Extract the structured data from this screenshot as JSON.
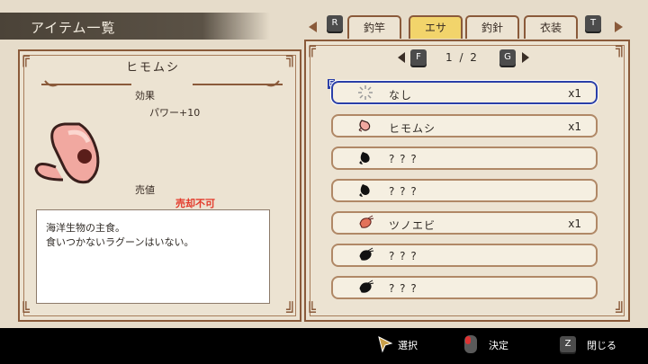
{
  "header": {
    "title": "アイテム一覧"
  },
  "tabs": {
    "left_key": "R",
    "right_key": "T",
    "items": [
      {
        "label": "釣竿",
        "active": false
      },
      {
        "label": "エサ",
        "active": true
      },
      {
        "label": "釣針",
        "active": false
      },
      {
        "label": "衣装",
        "active": false
      }
    ]
  },
  "detail": {
    "name": "ヒモムシ",
    "effect_label": "効果",
    "effect_value": "パワー+10",
    "sell_label": "売値",
    "sell_value": "売却不可",
    "description_line1": "海洋生物の主食。",
    "description_line2": "食いつかないラグーンはいない。"
  },
  "pager": {
    "prev_key": "F",
    "next_key": "G",
    "text": "1 / 2"
  },
  "list": {
    "items": [
      {
        "name": "なし",
        "qty": "x1",
        "icon": "empty-slot-icon",
        "selected": true
      },
      {
        "name": "ヒモムシ",
        "qty": "x1",
        "icon": "worm-icon"
      },
      {
        "name": "? ? ?",
        "qty": "",
        "icon": "unknown-silhouette-icon"
      },
      {
        "name": "? ? ?",
        "qty": "",
        "icon": "unknown-silhouette-icon"
      },
      {
        "name": "ツノエビ",
        "qty": "x1",
        "icon": "shrimp-icon"
      },
      {
        "name": "? ? ?",
        "qty": "",
        "icon": "unknown-silhouette-icon"
      },
      {
        "name": "? ? ?",
        "qty": "",
        "icon": "unknown-silhouette-icon"
      }
    ],
    "cursor_label": "E"
  },
  "footer": {
    "select_label": "選択",
    "confirm_label": "決定",
    "close_key": "Z",
    "close_label": "閉じる"
  },
  "colors": {
    "accent_tab": "#f2d46b",
    "frame": "#8a5a3a",
    "selected_border": "#2a3fa8",
    "unsellable": "#e33a2a"
  }
}
